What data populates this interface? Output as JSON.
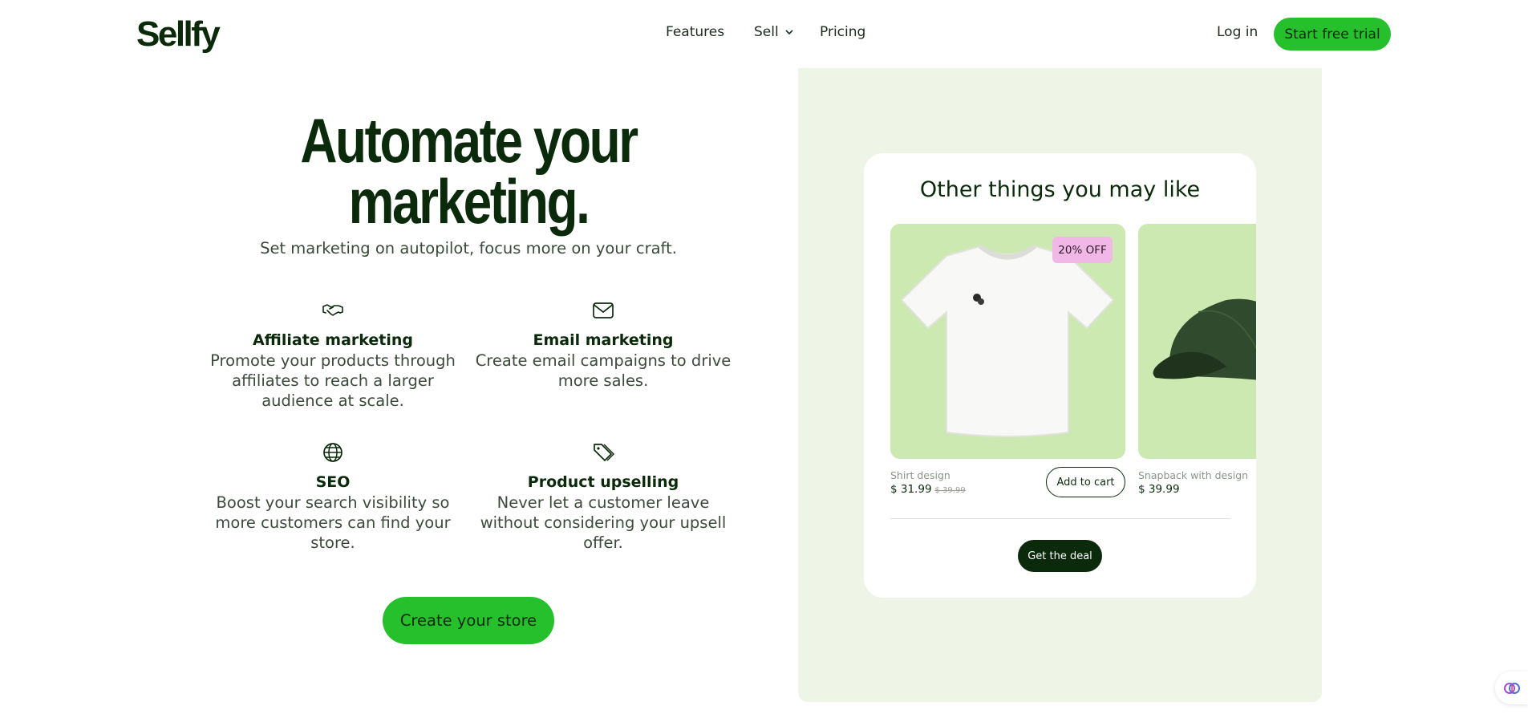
{
  "header": {
    "logo": "Sellfy",
    "nav": [
      "Features",
      "Sell",
      "Pricing"
    ],
    "login": "Log in",
    "trial": "Start free trial"
  },
  "hero": {
    "title_line1": "Automate your",
    "title_line2": "marketing.",
    "subtitle": "Set marketing on autopilot, focus more on your craft.",
    "cta": "Create your store"
  },
  "features": [
    {
      "icon": "handshake-icon",
      "title": "Affiliate marketing",
      "desc": "Promote your products through affiliates to reach a larger audience at scale."
    },
    {
      "icon": "envelope-icon",
      "title": "Email marketing",
      "desc": "Create email campaigns to drive more sales."
    },
    {
      "icon": "globe-icon",
      "title": "SEO",
      "desc": "Boost your search visibility so more customers can find your store."
    },
    {
      "icon": "tags-icon",
      "title": "Product upselling",
      "desc": "Never let a customer leave without considering your upsell offer."
    }
  ],
  "upsell_card": {
    "title": "Other things you may like",
    "products": [
      {
        "name": "Shirt design",
        "price": "$ 31.99",
        "old_price": "$ 39.99",
        "badge": "20% OFF",
        "button": "Add to cart"
      },
      {
        "name": "Snapback with design",
        "price": "$ 39.99"
      }
    ],
    "deal_button": "Get the deal"
  },
  "colors": {
    "brand_green": "#25c02b",
    "dark_green": "#0b2a0b",
    "panel_bg": "#eff5e6",
    "product_bg": "#cbe9b0",
    "badge_pink": "#f1b7e6"
  }
}
